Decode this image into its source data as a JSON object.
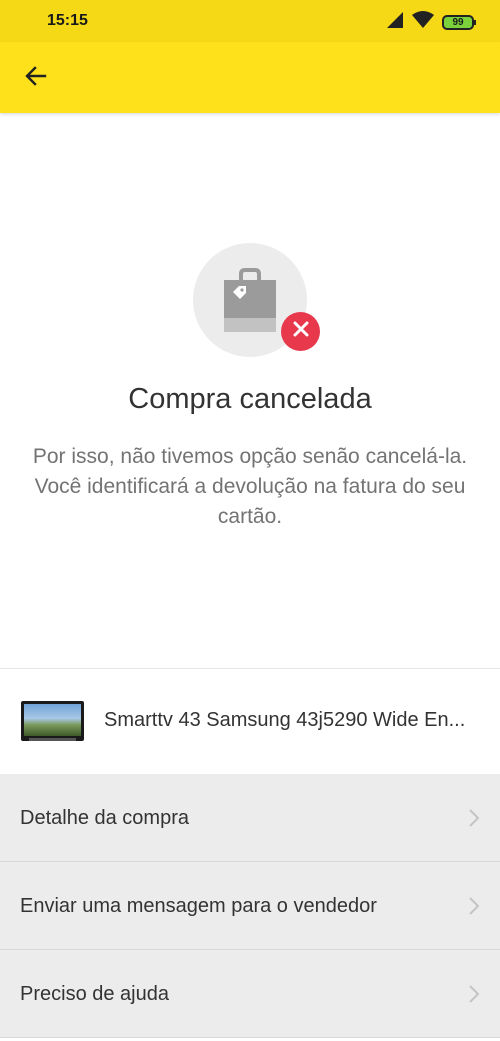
{
  "status_bar": {
    "time": "15:15",
    "battery": "99",
    "icons": [
      "signal-icon",
      "wifi-icon",
      "battery-icon"
    ]
  },
  "toolbar": {
    "back_icon": "arrow-left-icon",
    "background": "#ffe11b"
  },
  "status": {
    "icon": "shopping-bag-icon",
    "badge_icon": "close-icon",
    "badge_color": "#e8384c",
    "title": "Compra cancelada",
    "message": "Por isso, não tivemos opção senão cancelá-la. Você identificará a devolução na fatura do seu cartão."
  },
  "product": {
    "title": "Smarttv 43 Samsung 43j5290 Wide En...",
    "thumbnail_icon": "tv-thumbnail"
  },
  "options": [
    {
      "label": "Detalhe da compra"
    },
    {
      "label": "Enviar uma mensagem para o vendedor"
    },
    {
      "label": "Preciso de ajuda"
    }
  ]
}
